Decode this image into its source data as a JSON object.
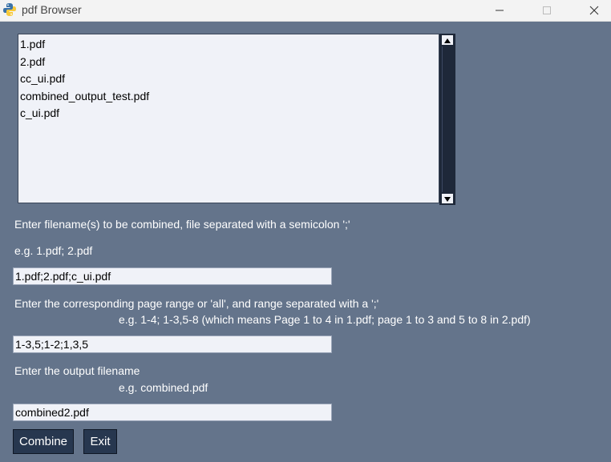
{
  "window": {
    "title": "pdf Browser"
  },
  "file_list": {
    "items": [
      "1.pdf",
      "2.pdf",
      "cc_ui.pdf",
      "combined_output_test.pdf",
      "c_ui.pdf"
    ]
  },
  "filenames_section": {
    "label": "Enter filename(s) to be combined, file separated with a semicolon ';'",
    "example": "e.g. 1.pdf; 2.pdf",
    "value": "1.pdf;2.pdf;c_ui.pdf"
  },
  "range_section": {
    "label": "Enter the corresponding page range or 'all', and range separated with a ';'",
    "example": "e.g. 1-4; 1-3,5-8 (which means Page 1 to 4 in 1.pdf; page 1 to 3 and 5 to 8 in 2.pdf)",
    "value": "1-3,5;1-2;1,3,5"
  },
  "output_section": {
    "label": "Enter the output filename",
    "example": "e.g. combined.pdf",
    "value": "combined2.pdf"
  },
  "buttons": {
    "combine": "Combine",
    "exit": "Exit"
  }
}
